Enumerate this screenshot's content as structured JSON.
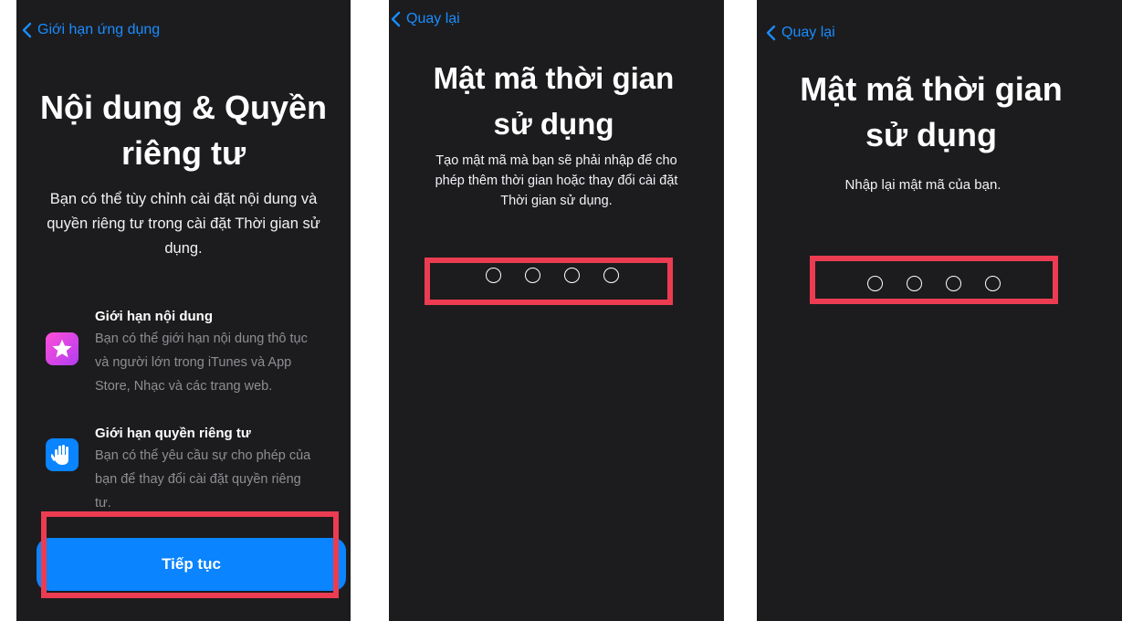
{
  "screen1": {
    "back_label": "Giới hạn ứng dụng",
    "title_line1": "Nội dung & Quyền",
    "title_line2": "riêng tư",
    "desc_line1": "Bạn có thể tùy chỉnh cài đặt nội dung và",
    "desc_line2": "quyền riêng tư trong cài đặt Thời gian sử",
    "desc_line3": "dụng.",
    "features": [
      {
        "title": "Giới hạn nội dung",
        "desc_line1": "Bạn có thể giới hạn nội dung thô tục",
        "desc_line2": "và người lớn trong iTunes và App",
        "desc_line3": "Store, Nhạc và các trang web.",
        "icon": "star-icon"
      },
      {
        "title": "Giới hạn quyền riêng tư",
        "desc_line1": "Bạn có thể yêu cầu sự cho phép của",
        "desc_line2": "bạn để thay đổi cài đặt quyền riêng",
        "desc_line3": "tư.",
        "icon": "hand-icon"
      }
    ],
    "continue_label": "Tiếp tục"
  },
  "screen2": {
    "back_label": "Quay lại",
    "title_line1": "Mật mã thời gian",
    "title_line2": "sử dụng",
    "desc_line1": "Tạo mật mã mà bạn sẽ phải nhập để cho",
    "desc_line2": "phép thêm thời gian hoặc thay đổi cài đặt",
    "desc_line3": "Thời gian sử dụng.",
    "passcode_length": 4
  },
  "screen3": {
    "back_label": "Quay lại",
    "title_line1": "Mật mã thời gian",
    "title_line2": "sử dụng",
    "desc_line1": "Nhập lại mật mã của bạn.",
    "passcode_length": 4
  },
  "colors": {
    "screen_bg": "#1c1c1e",
    "accent_blue": "#0a84ff",
    "link_blue": "#1a8cff",
    "highlight_red": "#ec3c52",
    "secondary_text": "#8e8e93"
  }
}
